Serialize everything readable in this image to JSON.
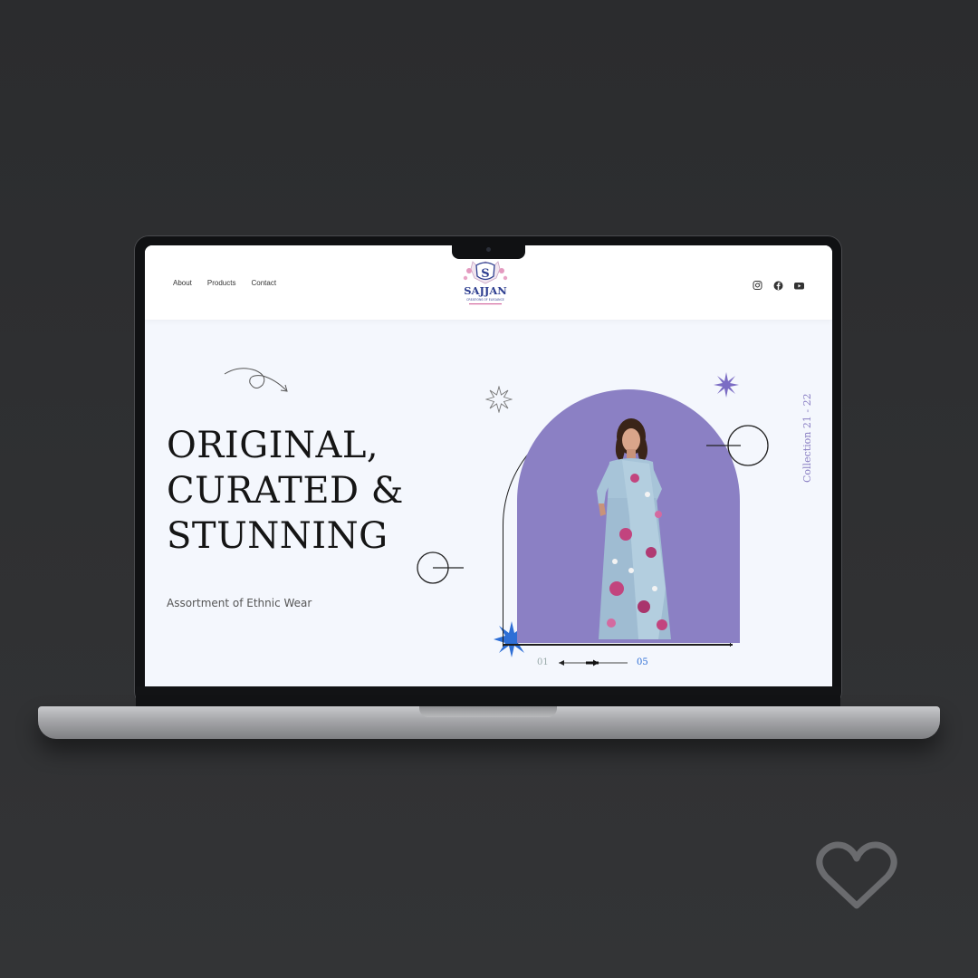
{
  "nav": {
    "about": "About",
    "products": "Products",
    "contact": "Contact"
  },
  "logo": {
    "letter": "S",
    "brand": "SAJJAN",
    "tagline": "CREATIONS OF ELEGANCE"
  },
  "social_icons": [
    "instagram-icon",
    "facebook-icon",
    "youtube-icon"
  ],
  "hero": {
    "title_lines": [
      "ORIGINAL,",
      "CURATED &",
      "STUNNING"
    ],
    "subtitle": "Assortment of Ethnic Wear"
  },
  "collection_label": "Collection 21 - 22",
  "slider": {
    "current": "01",
    "total": "05"
  },
  "colors": {
    "background": "#2b2c2e",
    "screen": "#f4f7fd",
    "arch": "#8b80c4",
    "accent_blue": "#2e6fd6",
    "accent_purple": "#7b6cc4"
  },
  "icons": {
    "favorite": "heart-icon"
  }
}
